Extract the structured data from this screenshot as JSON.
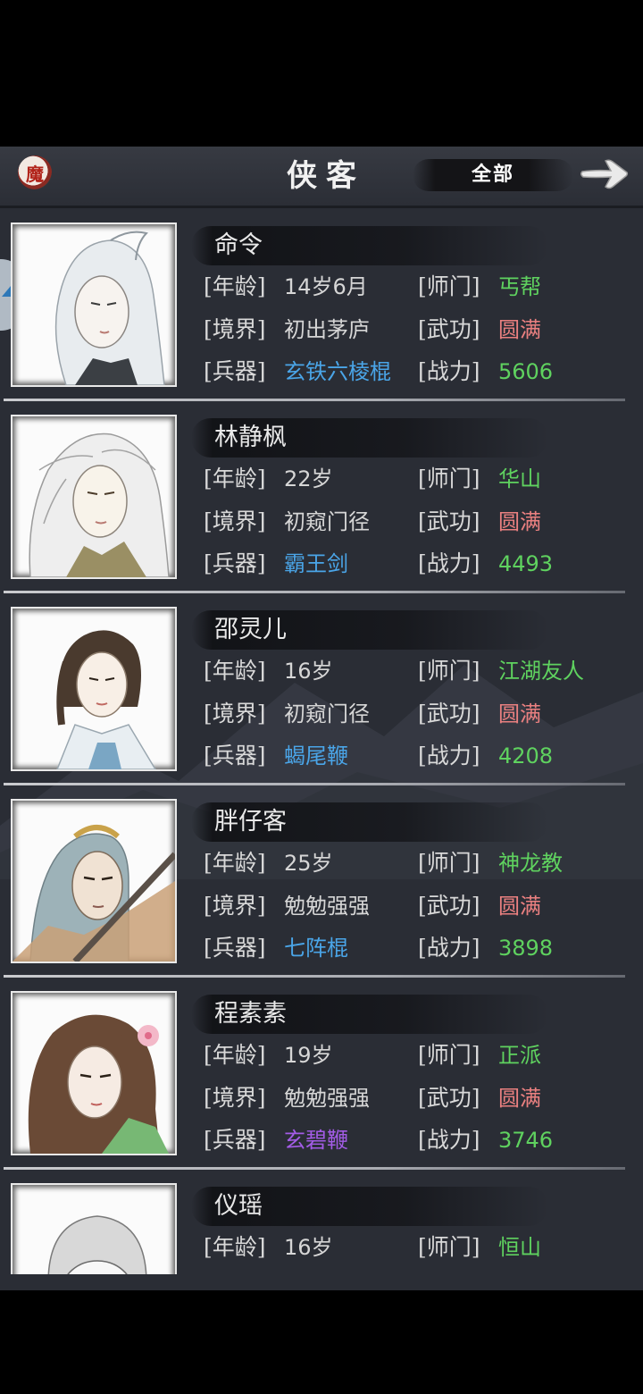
{
  "header": {
    "badge_char": "魔",
    "title": "侠客",
    "filter_label": "全部"
  },
  "labels": {
    "age": "[年龄]",
    "sect": "[师门]",
    "realm": "[境界]",
    "skill": "[武功]",
    "weapon": "[兵器]",
    "power": "[战力]"
  },
  "colors": {
    "green": "#5fd25f",
    "red": "#ea8080",
    "blue": "#4aa5e8",
    "purple": "#a35ce6"
  },
  "heroes": [
    {
      "name": "命令",
      "age": "14岁6月",
      "sect": "丐帮",
      "realm": "初出茅庐",
      "skill": "圆满",
      "weapon": "玄铁六棱棍",
      "power": "5606",
      "weapon_color": "blue"
    },
    {
      "name": "林静枫",
      "age": "22岁",
      "sect": "华山",
      "realm": "初窥门径",
      "skill": "圆满",
      "weapon": "霸王剑",
      "power": "4493",
      "weapon_color": "blue"
    },
    {
      "name": "邵灵儿",
      "age": "16岁",
      "sect": "江湖友人",
      "realm": "初窥门径",
      "skill": "圆满",
      "weapon": "蝎尾鞭",
      "power": "4208",
      "weapon_color": "blue"
    },
    {
      "name": "胖仔客",
      "age": "25岁",
      "sect": "神龙教",
      "realm": "勉勉强强",
      "skill": "圆满",
      "weapon": "七阵棍",
      "power": "3898",
      "weapon_color": "blue"
    },
    {
      "name": "程素素",
      "age": "19岁",
      "sect": "正派",
      "realm": "勉勉强强",
      "skill": "圆满",
      "weapon": "玄碧鞭",
      "power": "3746",
      "weapon_color": "purple"
    },
    {
      "name": "仪瑶",
      "age": "16岁",
      "sect": "恒山"
    }
  ]
}
